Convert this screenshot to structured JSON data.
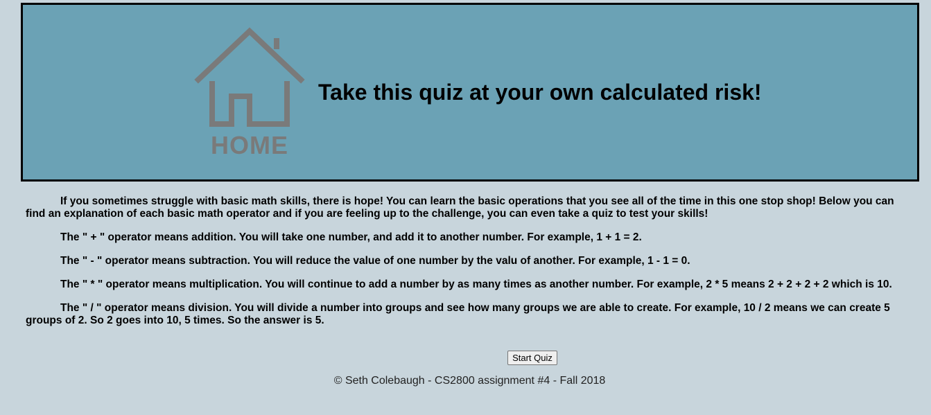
{
  "header": {
    "home_label": "HOME",
    "headline": "Take this quiz at your own calculated risk!",
    "bg_color": "#6ba2b5",
    "icon": "house-icon"
  },
  "content": {
    "paragraphs": [
      "If you sometimes struggle with basic math skills, there is hope! You can learn the basic operations that you see all of the time in this one stop shop! Below you can find an explanation of each basic math operator and if you are feeling up to the challenge, you can even take a quiz to test your skills!",
      "The \" + \" operator means addition. You will take one number, and add it to another number. For example, 1 + 1 = 2.",
      "The \" - \" operator means subtraction. You will reduce the value of one number by the valu of another. For example, 1 - 1 = 0.",
      "The \" * \" operator means multiplication. You will continue to add a number by as many times as another number. For example, 2 * 5 means 2 + 2 + 2 + 2 which is 10.",
      "The \" / \" operator means division. You will divide a number into groups and see how many groups we are able to create. For example, 10 / 2 means we can create 5 groups of 2. So 2 goes into 10, 5 times. So the answer is 5."
    ]
  },
  "actions": {
    "start_quiz_label": "Start Quiz"
  },
  "footer": {
    "text": "© Seth Colebaugh - CS2800 assignment #4 - Fall 2018"
  }
}
